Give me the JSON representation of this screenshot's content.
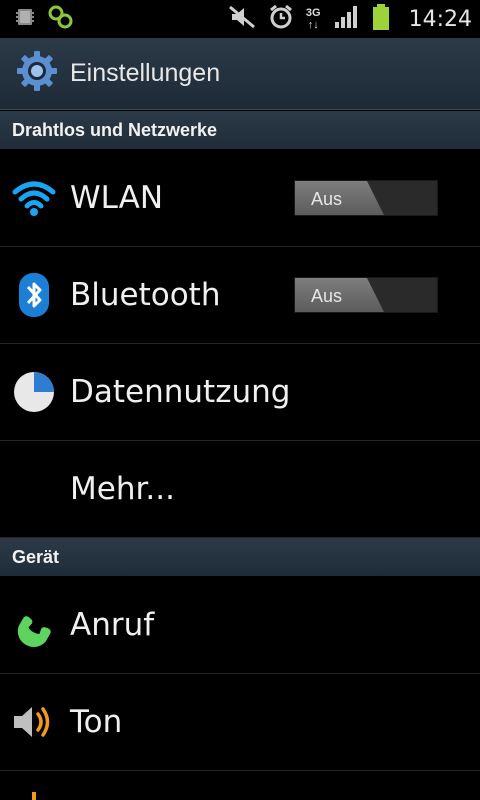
{
  "status_bar": {
    "time": "14:24",
    "network_type": "3G",
    "icons": [
      "sd-card-icon",
      "notification-app-icon",
      "mute-icon",
      "alarm-icon",
      "signal-icon",
      "battery-icon"
    ]
  },
  "action_bar": {
    "title": "Einstellungen",
    "icon": "settings-gear-icon"
  },
  "sections": [
    {
      "title": "Drahtlos und Netzwerke"
    },
    {
      "title": "Gerät"
    }
  ],
  "items": [
    {
      "label": "WLAN",
      "icon": "wifi-icon",
      "toggle": "Aus"
    },
    {
      "label": "Bluetooth",
      "icon": "bluetooth-icon",
      "toggle": "Aus"
    },
    {
      "label": "Datennutzung",
      "icon": "data-usage-icon"
    },
    {
      "label": "Mehr...",
      "icon": ""
    },
    {
      "label": "Anruf",
      "icon": "phone-icon"
    },
    {
      "label": "Ton",
      "icon": "speaker-icon"
    }
  ],
  "colors": {
    "accent": "#19a5f5",
    "phone_green": "#5fd35f",
    "speaker_orange": "#f39a1d",
    "battery_green": "#9cd33b"
  }
}
